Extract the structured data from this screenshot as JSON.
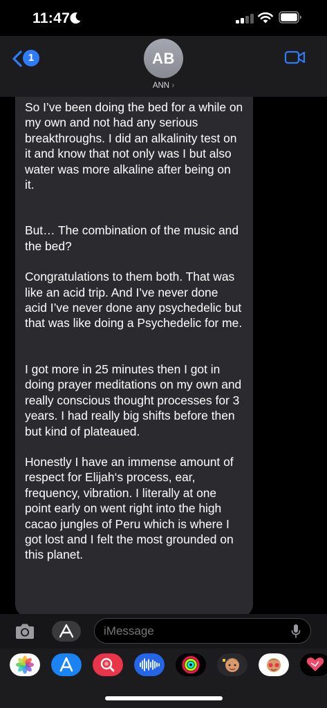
{
  "status_bar": {
    "time": "11:47",
    "icons": [
      "moon-icon",
      "cellular-signal-icon",
      "wifi-icon",
      "battery-icon"
    ]
  },
  "header": {
    "back_badge_count": "1",
    "avatar_initials": "AB",
    "contact_name": "ANN",
    "contact_chevron": "›",
    "icons": [
      "back-chevron-icon",
      "video-camera-icon"
    ]
  },
  "message": {
    "paragraphs": [
      "So I’ve been doing the bed for a while on my own and not had any serious breakthroughs. I did an alkalinity test on it and know that not only was I but also water was more alkaline after being on it.",
      "But… The combination of the music and the bed?",
      "Congratulations to them both. That was like an acid trip. And I’ve never done acid I’ve never done any psychedelic but that was like doing a Psychedelic for me.",
      "I got more in 25 minutes then I got in doing prayer meditations on my own and really conscious thought processes for 3 years. I had really big shifts before then but kind of plateaued.",
      "Honestly I have an immense amount of respect for Elijah‘s process, ear, frequency, vibration. I literally at one point early on went right into the high cacao jungles of Peru which is where I got lost and I felt the most grounded on this planet."
    ]
  },
  "input_bar": {
    "placeholder": "iMessage",
    "icons": [
      "camera-icon",
      "app-store-icon",
      "microphone-icon"
    ]
  },
  "app_drawer": {
    "apps": [
      "photos-app-icon",
      "app-store-app-icon",
      "image-search-app-icon",
      "audio-message-app-icon",
      "activity-app-icon",
      "memoji-app-icon",
      "memoji-stickers-app-icon",
      "digital-touch-app-icon"
    ]
  },
  "colors": {
    "accent": "#2f7cf6",
    "bubble": "#2b2b2f",
    "header_bg": "#1c1c1e"
  }
}
